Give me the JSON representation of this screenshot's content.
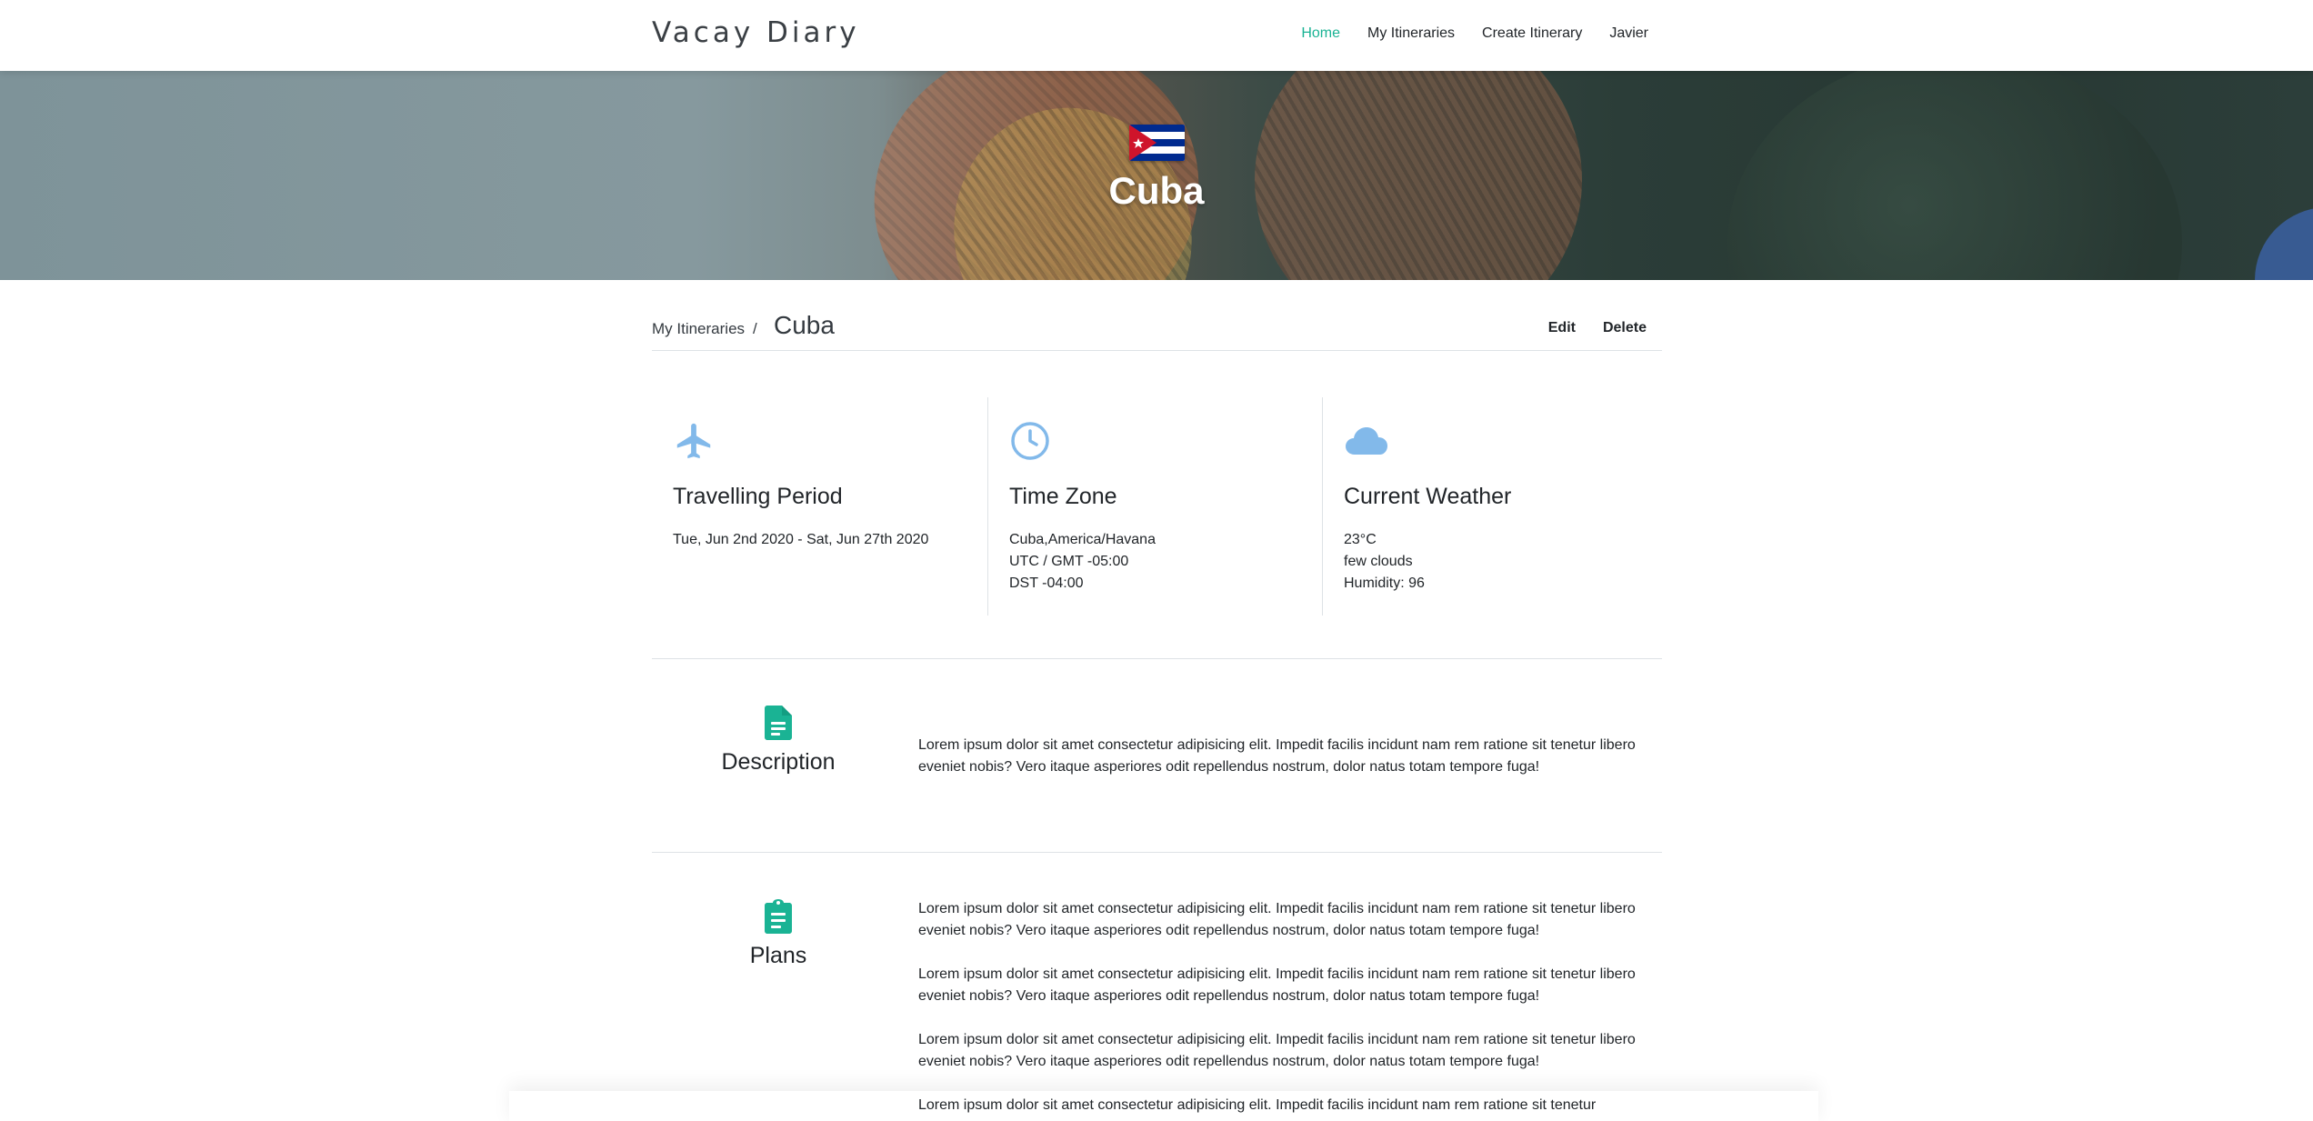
{
  "app": {
    "brand": "Vacay Diary"
  },
  "nav": {
    "items": [
      {
        "label": "Home",
        "active": true
      },
      {
        "label": "My Itineraries",
        "active": false
      },
      {
        "label": "Create Itinerary",
        "active": false
      },
      {
        "label": "Javier",
        "active": false
      }
    ]
  },
  "hero": {
    "title": "Cuba",
    "flag_icon": "cuba-flag-icon"
  },
  "breadcrumb": {
    "parent": "My Itineraries",
    "separator": "/",
    "current": "Cuba",
    "actions": {
      "edit": "Edit",
      "delete": "Delete"
    }
  },
  "cards": {
    "travel": {
      "icon": "airplane-icon",
      "title": "Travelling Period",
      "lines": [
        "Tue, Jun 2nd 2020 - Sat, Jun 27th 2020"
      ]
    },
    "timezone": {
      "icon": "clock-icon",
      "title": "Time Zone",
      "lines": [
        "Cuba,America/Havana",
        "UTC / GMT -05:00",
        "DST -04:00"
      ]
    },
    "weather": {
      "icon": "cloud-icon",
      "title": "Current Weather",
      "lines": [
        "23°C",
        "few clouds",
        "Humidity: 96"
      ]
    }
  },
  "sections": {
    "description": {
      "icon": "document-icon",
      "title": "Description",
      "paragraphs": [
        "Lorem ipsum dolor sit amet consectetur adipisicing elit. Impedit facilis incidunt nam rem ratione sit tenetur libero eveniet nobis? Vero itaque asperiores odit repellendus nostrum, dolor natus totam tempore fuga!"
      ]
    },
    "plans": {
      "icon": "clipboard-icon",
      "title": "Plans",
      "paragraphs": [
        "Lorem ipsum dolor sit amet consectetur adipisicing elit. Impedit facilis incidunt nam rem ratione sit tenetur libero eveniet nobis? Vero itaque asperiores odit repellendus nostrum, dolor natus totam tempore fuga!",
        "Lorem ipsum dolor sit amet consectetur adipisicing elit. Impedit facilis incidunt nam rem ratione sit tenetur libero eveniet nobis? Vero itaque asperiores odit repellendus nostrum, dolor natus totam tempore fuga!",
        "Lorem ipsum dolor sit amet consectetur adipisicing elit. Impedit facilis incidunt nam rem ratione sit tenetur libero eveniet nobis? Vero itaque asperiores odit repellendus nostrum, dolor natus totam tempore fuga!",
        "Lorem ipsum dolor sit amet consectetur adipisicing elit. Impedit facilis incidunt nam rem ratione sit tenetur"
      ]
    }
  },
  "colors": {
    "accent": "#1ab394",
    "icon_blue": "#82b9ea",
    "text": "#212529",
    "divider": "#dee2e6"
  }
}
